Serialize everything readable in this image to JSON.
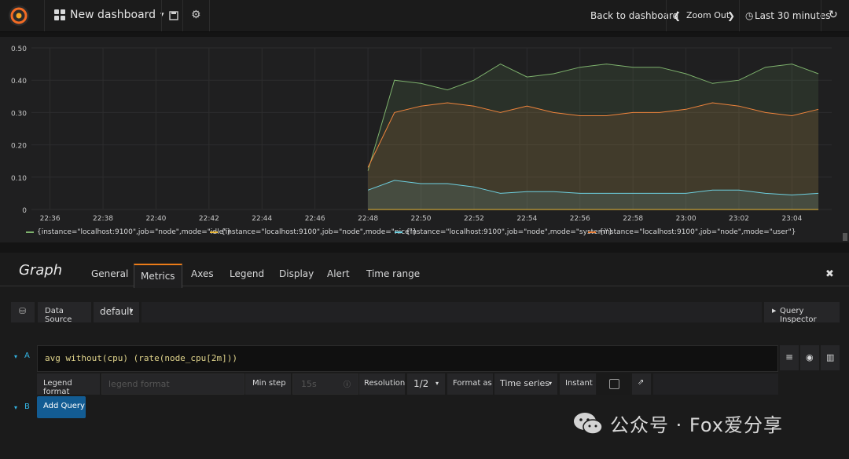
{
  "topbar": {
    "dashboard_title": "New dashboard",
    "back_label": "Back to dashboard",
    "zoom_out_label": "Zoom Out",
    "time_range_label": "Last 30 minutes"
  },
  "chart_data": {
    "type": "area",
    "x": [
      "22:48",
      "22:49",
      "22:50",
      "22:51",
      "22:52",
      "22:53",
      "22:54",
      "22:55",
      "22:56",
      "22:57",
      "22:58",
      "22:59",
      "23:00",
      "23:01",
      "23:02",
      "23:03",
      "23:04",
      "23:05"
    ],
    "x_ticks": [
      "22:36",
      "22:38",
      "22:40",
      "22:42",
      "22:44",
      "22:46",
      "22:48",
      "22:50",
      "22:52",
      "22:54",
      "22:56",
      "22:58",
      "23:00",
      "23:02",
      "23:04"
    ],
    "y_ticks": [
      "0",
      "0.10",
      "0.20",
      "0.30",
      "0.40",
      "0.50"
    ],
    "ylim": [
      0,
      0.5
    ],
    "series": [
      {
        "name": "{instance=\"localhost:9100\",job=\"node\",mode=\"idle\"}",
        "color": "#7eb26d",
        "values": [
          0.12,
          0.4,
          0.39,
          0.37,
          0.4,
          0.45,
          0.41,
          0.42,
          0.44,
          0.45,
          0.44,
          0.44,
          0.42,
          0.39,
          0.4,
          0.44,
          0.45,
          0.42
        ]
      },
      {
        "name": "{instance=\"localhost:9100\",job=\"node\",mode=\"nice\"}",
        "color": "#eab839",
        "values": [
          0,
          0,
          0,
          0,
          0,
          0,
          0,
          0,
          0,
          0,
          0,
          0,
          0,
          0,
          0,
          0,
          0,
          0
        ]
      },
      {
        "name": "{instance=\"localhost:9100\",job=\"node\",mode=\"system\"}",
        "color": "#6ed0e0",
        "values": [
          0.06,
          0.09,
          0.08,
          0.08,
          0.07,
          0.05,
          0.055,
          0.055,
          0.05,
          0.05,
          0.05,
          0.05,
          0.05,
          0.06,
          0.06,
          0.05,
          0.045,
          0.05
        ]
      },
      {
        "name": "{instance=\"localhost:9100\",job=\"node\",mode=\"user\"}",
        "color": "#ef843c",
        "values": [
          0.13,
          0.3,
          0.32,
          0.33,
          0.32,
          0.3,
          0.32,
          0.3,
          0.29,
          0.29,
          0.3,
          0.3,
          0.31,
          0.33,
          0.32,
          0.3,
          0.29,
          0.31
        ]
      }
    ]
  },
  "editor": {
    "panel_title": "Graph",
    "tabs": [
      "General",
      "Metrics",
      "Axes",
      "Legend",
      "Display",
      "Alert",
      "Time range"
    ],
    "active_tab": "Metrics",
    "data_source_label": "Data Source",
    "data_source_value": "default",
    "query_inspector_label": "Query Inspector",
    "query_a_letter": "A",
    "query_text": "avg without(cpu) (rate(node_cpu[2m]))",
    "legend_format_label": "Legend format",
    "legend_format_placeholder": "legend format",
    "min_step_label": "Min step",
    "min_step_placeholder": "15s",
    "resolution_label": "Resolution",
    "resolution_value": "1/2",
    "format_as_label": "Format as",
    "format_as_value": "Time series",
    "instant_label": "Instant",
    "query_b_letter": "B",
    "add_query_label": "Add Query"
  },
  "watermark": "公众号 · Fox爱分享"
}
